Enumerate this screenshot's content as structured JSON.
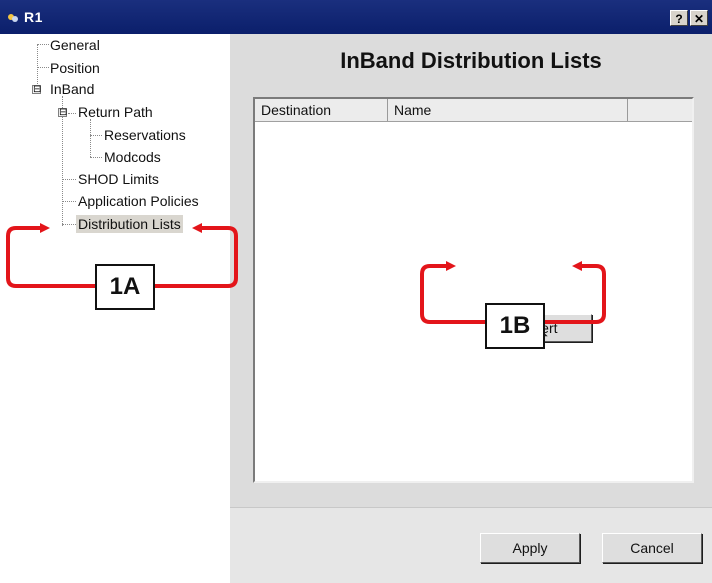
{
  "window": {
    "title": "R1",
    "help_button": "?",
    "close_button": "✕"
  },
  "tree": {
    "items": [
      {
        "label": "General"
      },
      {
        "label": "Position"
      },
      {
        "label": "InBand",
        "expander": "⊟"
      },
      {
        "label": "Return Path",
        "expander": "⊟"
      },
      {
        "label": "Reservations"
      },
      {
        "label": "Modcods"
      },
      {
        "label": "SHOD Limits"
      },
      {
        "label": "Application Policies"
      },
      {
        "label": "Distribution Lists",
        "selected": true
      }
    ]
  },
  "main": {
    "title": "InBand Distribution Lists",
    "list": {
      "columns": [
        "Destination",
        "Name"
      ]
    },
    "insert_label": "Insert",
    "apply_label": "Apply",
    "cancel_label": "Cancel"
  },
  "annotations": {
    "a_label": "1A",
    "b_label": "1B",
    "arrow_color": "#e3151a"
  }
}
